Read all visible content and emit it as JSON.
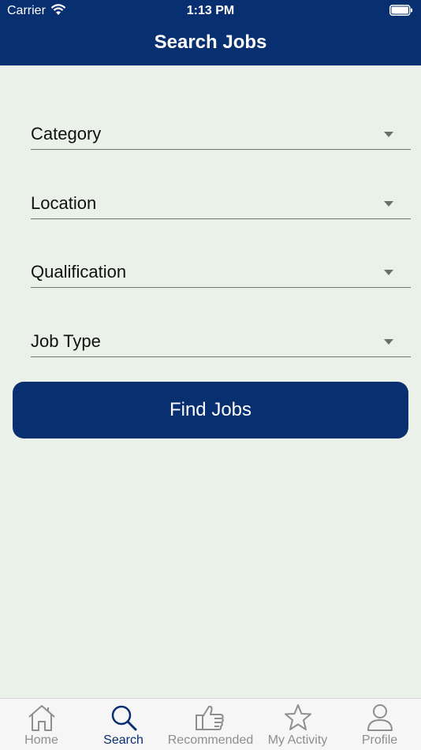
{
  "status_bar": {
    "carrier": "Carrier",
    "time": "1:13 PM"
  },
  "header": {
    "title": "Search Jobs"
  },
  "form": {
    "fields": [
      {
        "label": "Category"
      },
      {
        "label": "Location"
      },
      {
        "label": "Qualification"
      },
      {
        "label": "Job Type"
      }
    ],
    "submit_label": "Find Jobs"
  },
  "tabbar": {
    "items": [
      {
        "label": "Home",
        "icon": "home-icon",
        "active": false
      },
      {
        "label": "Search",
        "icon": "search-icon",
        "active": true
      },
      {
        "label": "Recommended",
        "icon": "thumbs-up-icon",
        "active": false
      },
      {
        "label": "My Activity",
        "icon": "star-icon",
        "active": false
      },
      {
        "label": "Profile",
        "icon": "person-icon",
        "active": false
      }
    ]
  },
  "colors": {
    "brand": "#082f6f",
    "background": "#eaf1e9",
    "inactive_tab": "#8e8e8e"
  }
}
